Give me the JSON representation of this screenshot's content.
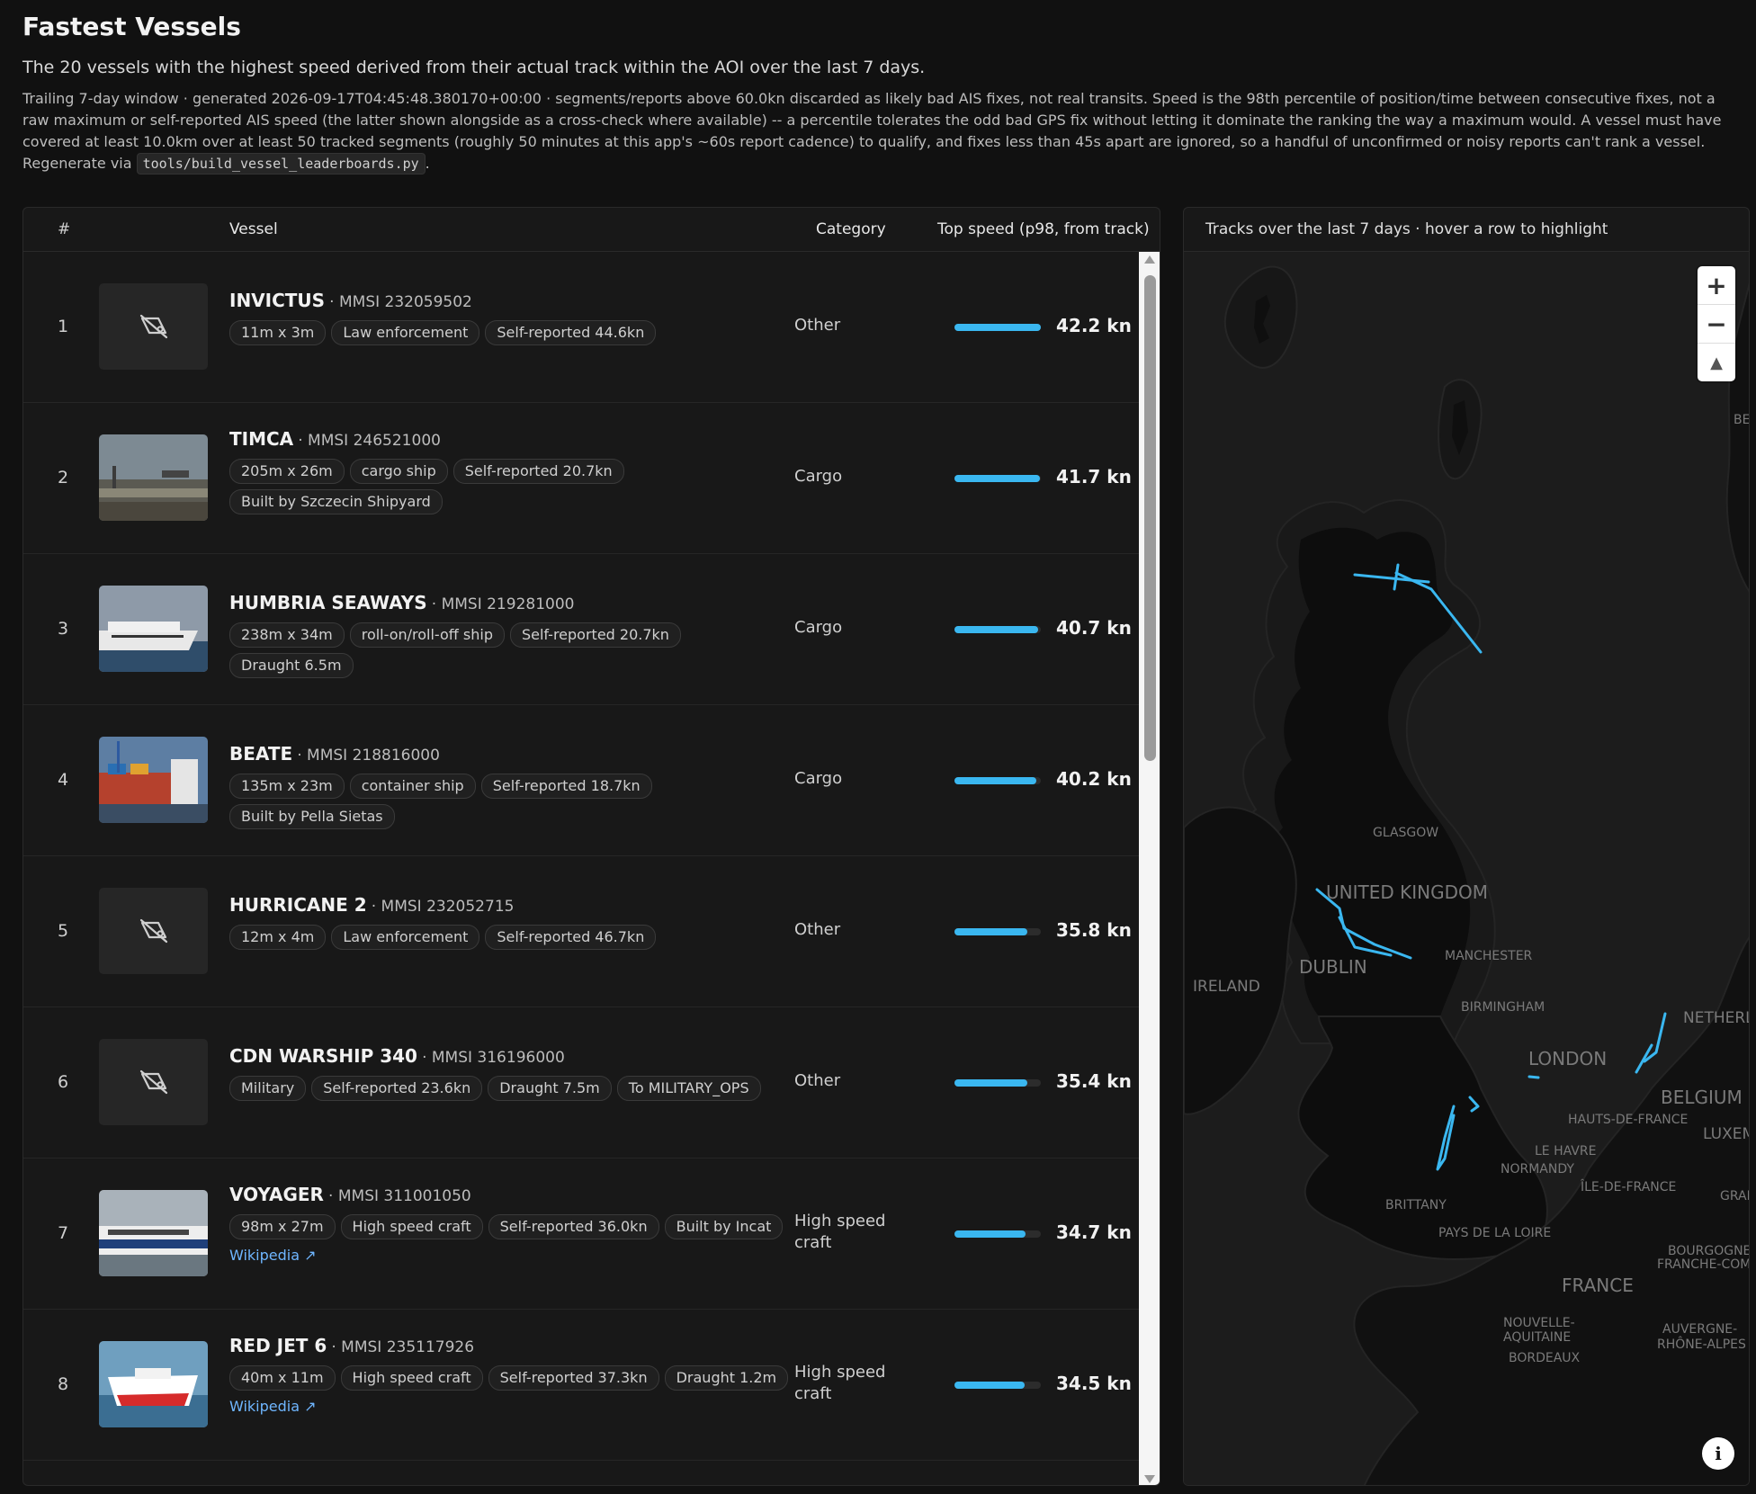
{
  "header": {
    "title": "Fastest Vessels",
    "subtitle": "The 20 vessels with the highest speed derived from their actual track within the AOI over the last 7 days.",
    "description": "Trailing 7-day window · generated 2026-09-17T04:45:48.380170+00:00 · segments/reports above 60.0kn discarded as likely bad AIS fixes, not real transits. Speed is the 98th percentile of position/time between consecutive fixes, not a raw maximum or self-reported AIS speed (the latter shown alongside as a cross-check where available) -- a percentile tolerates the odd bad GPS fix without letting it dominate the ranking the way a maximum would. A vessel must have covered at least 10.0km over at least 50 tracked segments (roughly 50 minutes at this app's ~60s report cadence) to qualify, and fixes less than 45s apart are ignored, so a handful of unconfirmed or noisy reports can't rank a vessel. Regenerate via",
    "script_name": "tools/build_vessel_leaderboards.py",
    "trailing_period": "."
  },
  "table": {
    "columns": {
      "rank": "#",
      "vessel": "Vessel",
      "category": "Category",
      "speed": "Top speed (p98, from track)"
    },
    "speed_scale_max_kn": 42.2,
    "rows": [
      {
        "rank": "1",
        "name": "INVICTUS",
        "mmsi": "· MMSI 232059502",
        "photo": "no-photo",
        "chips": [
          "11m x 3m",
          "Law enforcement",
          "Self-reported 44.6kn"
        ],
        "link": "",
        "category": "Other",
        "speed": 42.2,
        "speed_label": "42.2 kn"
      },
      {
        "rank": "2",
        "name": "TIMCA",
        "mmsi": "· MMSI 246521000",
        "photo": "harbour",
        "chips": [
          "205m x 26m",
          "cargo ship",
          "Self-reported 20.7kn",
          "Built by Szczecin Shipyard"
        ],
        "link": "",
        "category": "Cargo",
        "speed": 41.7,
        "speed_label": "41.7 kn"
      },
      {
        "rank": "3",
        "name": "HUMBRIA SEAWAYS",
        "mmsi": "· MMSI 219281000",
        "photo": "ferry",
        "chips": [
          "238m x 34m",
          "roll-on/roll-off ship",
          "Self-reported 20.7kn",
          "Draught 6.5m"
        ],
        "link": "",
        "category": "Cargo",
        "speed": 40.7,
        "speed_label": "40.7 kn"
      },
      {
        "rank": "4",
        "name": "BEATE",
        "mmsi": "· MMSI 218816000",
        "photo": "container",
        "chips": [
          "135m x 23m",
          "container ship",
          "Self-reported 18.7kn",
          "Built by Pella Sietas"
        ],
        "link": "",
        "category": "Cargo",
        "speed": 40.2,
        "speed_label": "40.2 kn"
      },
      {
        "rank": "5",
        "name": "HURRICANE 2",
        "mmsi": "· MMSI 232052715",
        "photo": "no-photo",
        "chips": [
          "12m x 4m",
          "Law enforcement",
          "Self-reported 46.7kn"
        ],
        "link": "",
        "category": "Other",
        "speed": 35.8,
        "speed_label": "35.8 kn"
      },
      {
        "rank": "6",
        "name": "CDN WARSHIP 340",
        "mmsi": "· MMSI 316196000",
        "photo": "no-photo",
        "chips": [
          "Military",
          "Self-reported 23.6kn",
          "Draught 7.5m",
          "To MILITARY_OPS"
        ],
        "link": "",
        "category": "Other",
        "speed": 35.4,
        "speed_label": "35.4 kn"
      },
      {
        "rank": "7",
        "name": "VOYAGER",
        "mmsi": "· MMSI 311001050",
        "photo": "fastferry",
        "chips": [
          "98m x 27m",
          "High speed craft",
          "Self-reported 36.0kn",
          "Built by Incat"
        ],
        "link": "Wikipedia ↗",
        "category": "High speed craft",
        "speed": 34.7,
        "speed_label": "34.7 kn"
      },
      {
        "rank": "8",
        "name": "RED JET 6",
        "mmsi": "· MMSI 235117926",
        "photo": "redjet",
        "chips": [
          "40m x 11m",
          "High speed craft",
          "Self-reported 37.3kn",
          "Draught 1.2m"
        ],
        "link": "Wikipedia ↗",
        "category": "High speed craft",
        "speed": 34.5,
        "speed_label": "34.5 kn"
      }
    ]
  },
  "map": {
    "header": "Tracks over the last 7 days · hover a row to highlight",
    "controls": {
      "zoom_in": "+",
      "zoom_out": "−",
      "compass": "▲"
    },
    "info": "i",
    "track_color": "#3ab7f0",
    "labels": [
      "GLASGOW",
      "UNITED KINGDOM",
      "MANCHESTER",
      "DUBLIN",
      "IRELAND",
      "BIRMINGHAM",
      "LONDON",
      "NETHERL",
      "BELGIUM",
      "HAUTS-DE-FRANCE",
      "LUXEM",
      "LE HAVRE",
      "NORMANDY",
      "ÎLE-DE-FRANCE",
      "GRAN",
      "BRITTANY",
      "PAYS DE LA LOIRE",
      "BOURGOGNE",
      "FRANCHE-COM",
      "FRANCE",
      "NOUVELLE-",
      "AQUITAINE",
      "BORDEAUX",
      "AUVERGNE-",
      "RHÔNE-ALPES",
      "BEI"
    ]
  }
}
